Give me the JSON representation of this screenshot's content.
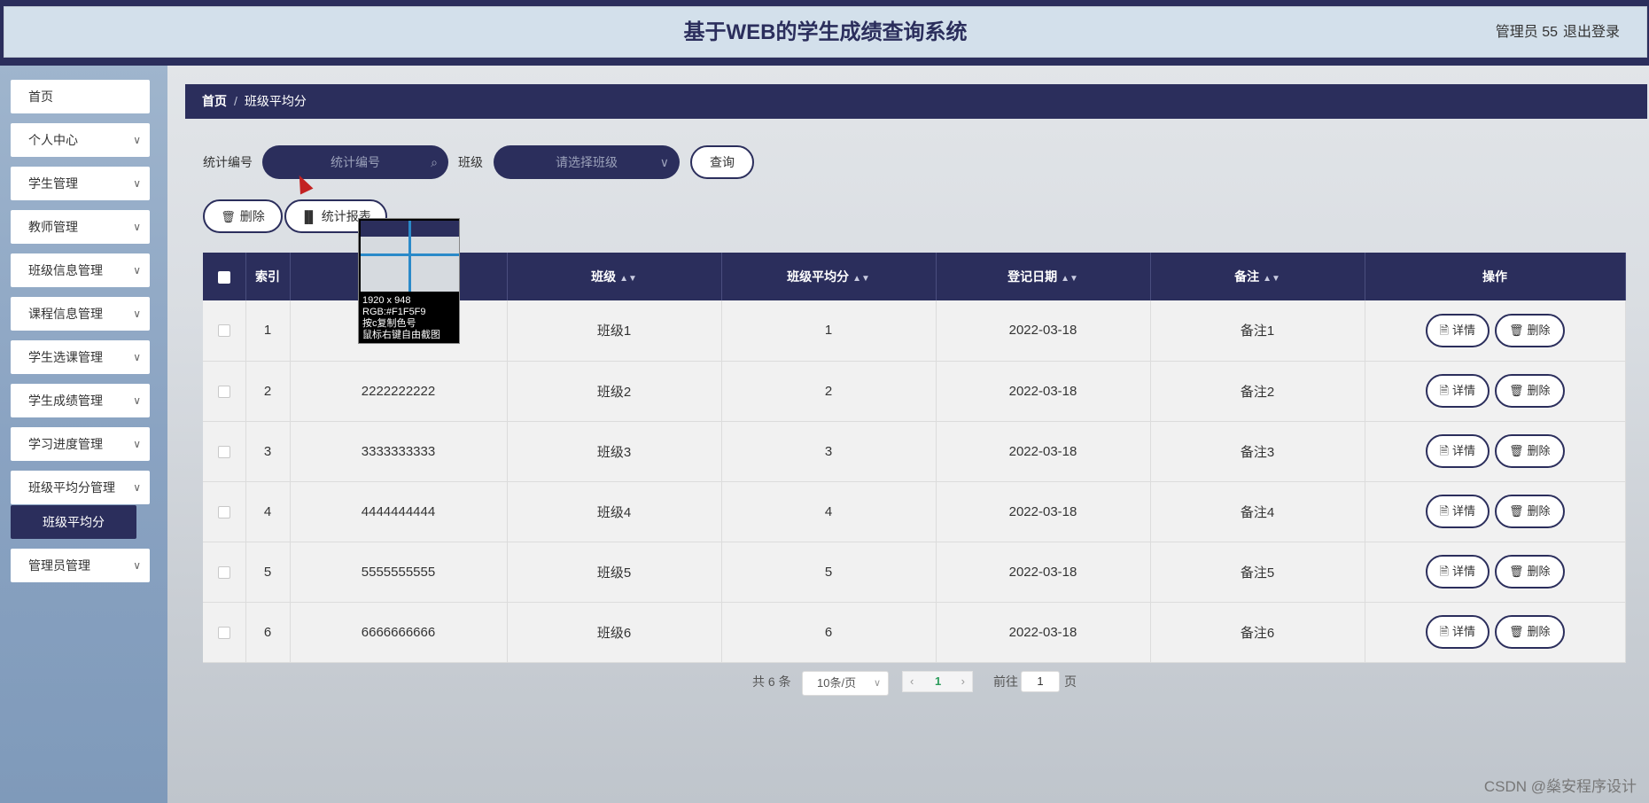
{
  "header": {
    "title": "基于WEB的学生成绩查询系统",
    "user": "管理员 55",
    "logout": "退出登录"
  },
  "sidebar": {
    "items": [
      {
        "label": "首页",
        "expandable": false
      },
      {
        "label": "个人中心",
        "expandable": true
      },
      {
        "label": "学生管理",
        "expandable": true
      },
      {
        "label": "教师管理",
        "expandable": true
      },
      {
        "label": "班级信息管理",
        "expandable": true
      },
      {
        "label": "课程信息管理",
        "expandable": true
      },
      {
        "label": "学生选课管理",
        "expandable": true
      },
      {
        "label": "学生成绩管理",
        "expandable": true
      },
      {
        "label": "学习进度管理",
        "expandable": true
      },
      {
        "label": "班级平均分管理",
        "expandable": true
      },
      {
        "label": "管理员管理",
        "expandable": true
      }
    ],
    "active_sub": "班级平均分"
  },
  "breadcrumb": {
    "home": "首页",
    "separator": "/",
    "current": "班级平均分"
  },
  "search": {
    "code_label": "统计编号",
    "code_placeholder": "统计编号",
    "class_label": "班级",
    "class_placeholder": "请选择班级",
    "query_button": "查询"
  },
  "actions": {
    "delete": "删除",
    "report": "统计报表"
  },
  "table": {
    "headers": {
      "index": "索引",
      "code": "",
      "class": "班级",
      "avg": "班级平均分",
      "date": "登记日期",
      "remark": "备注",
      "ops": "操作"
    },
    "rows": [
      {
        "index": "1",
        "code": "",
        "class": "班级1",
        "avg": "1",
        "date": "2022-03-18",
        "remark": "备注1"
      },
      {
        "index": "2",
        "code": "2222222222",
        "class": "班级2",
        "avg": "2",
        "date": "2022-03-18",
        "remark": "备注2"
      },
      {
        "index": "3",
        "code": "3333333333",
        "class": "班级3",
        "avg": "3",
        "date": "2022-03-18",
        "remark": "备注3"
      },
      {
        "index": "4",
        "code": "4444444444",
        "class": "班级4",
        "avg": "4",
        "date": "2022-03-18",
        "remark": "备注4"
      },
      {
        "index": "5",
        "code": "5555555555",
        "class": "班级5",
        "avg": "5",
        "date": "2022-03-18",
        "remark": "备注5"
      },
      {
        "index": "6",
        "code": "6666666666",
        "class": "班级6",
        "avg": "6",
        "date": "2022-03-18",
        "remark": "备注6"
      }
    ],
    "detail_label": "详情",
    "delete_label": "删除"
  },
  "pager": {
    "total": "共 6 条",
    "page_size": "10条/页",
    "current": "1",
    "goto": "前往",
    "goto_value": "1",
    "page_unit": "页"
  },
  "magnifier": {
    "size": "1920 x 948",
    "rgb": "RGB:#F1F5F9",
    "hint1": "按c复制色号",
    "hint2": "鼠标右键自由截图"
  },
  "watermark": "CSDN @燊安程序设计"
}
